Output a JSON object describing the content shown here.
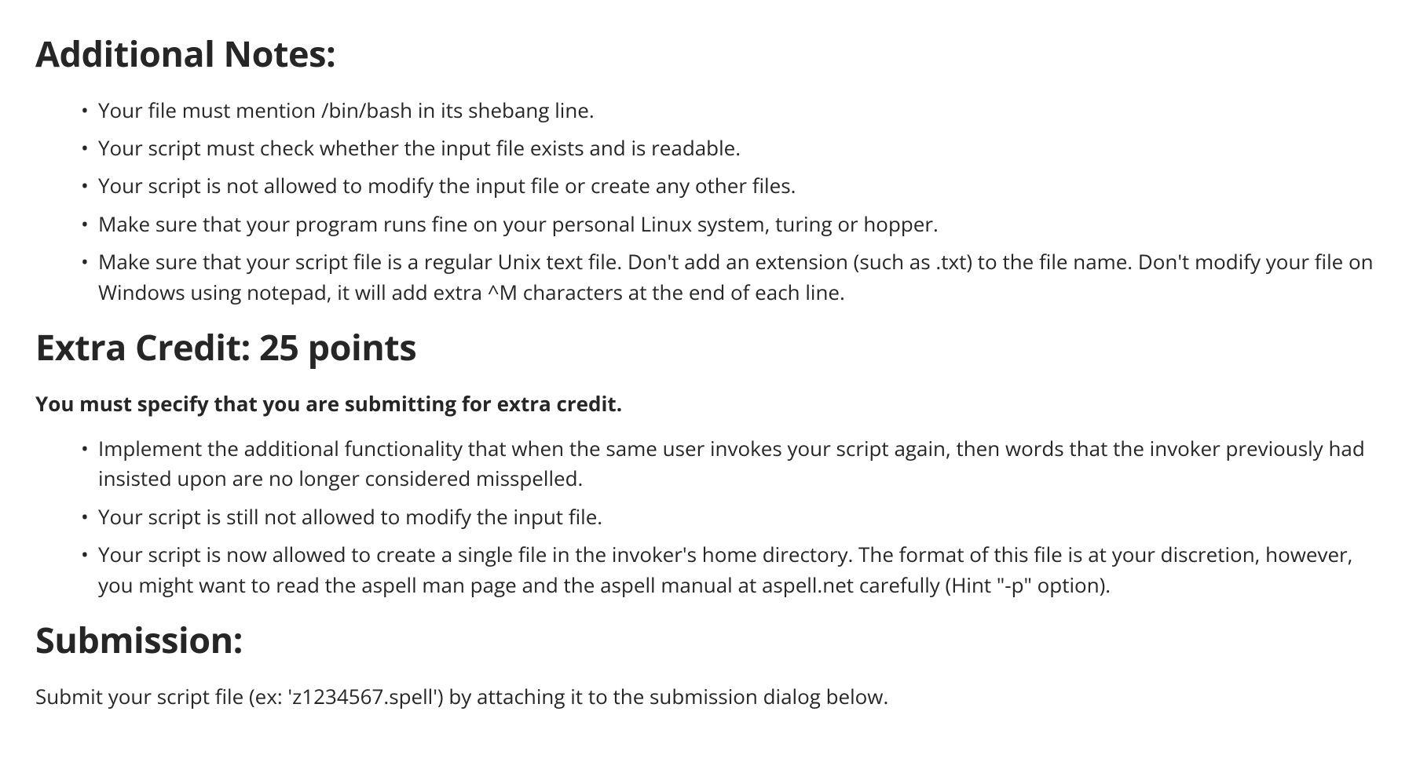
{
  "sections": {
    "additional_notes": {
      "heading": "Additional Notes:",
      "items": [
        "Your file must mention /bin/bash in its shebang line.",
        "Your script must check whether the input file exists and is readable.",
        "Your script is not allowed to modify the input file or create any other files.",
        "Make sure that your program runs fine on your personal Linux system, turing or hopper.",
        "Make sure that your script file is a regular Unix text file. Don't add an extension (such as .txt) to the file name. Don't modify your file on Windows using notepad, it will add extra ^M characters at the end of each line."
      ]
    },
    "extra_credit": {
      "heading": "Extra Credit: 25 points",
      "bold_note": "You must specify that you are submitting for extra credit.",
      "items": [
        "Implement the additional functionality that when the same user invokes your script again, then words that the invoker previously had insisted upon are no longer considered misspelled.",
        "Your script is still not allowed to modify the input file.",
        "Your script is now allowed to create a single file in the invoker's home directory. The format of this file is at your discretion, however, you might want to read the aspell man page and the aspell manual at aspell.net carefully (Hint \"-p\" option)."
      ]
    },
    "submission": {
      "heading": "Submission:",
      "text": "Submit your script file (ex: 'z1234567.spell') by attaching it to the submission dialog below."
    }
  }
}
